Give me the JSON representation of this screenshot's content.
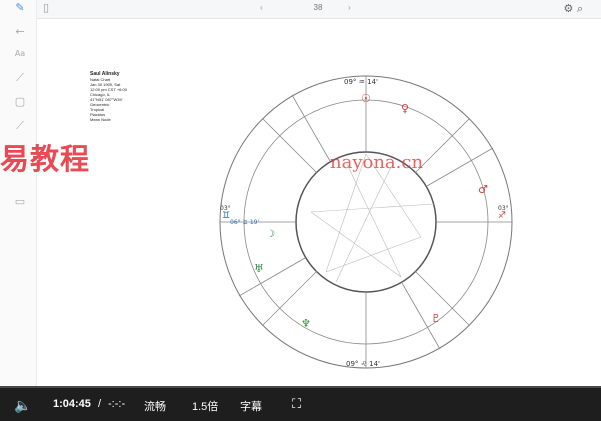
{
  "toolbar": {
    "page_indicator": "38",
    "icons": [
      "pen-icon",
      "sidebar-icon",
      "search-icon",
      "more-icon"
    ]
  },
  "sidebar": {
    "tools": [
      "pen-icon",
      "arrow-icon",
      "text-icon",
      "line-icon",
      "rectangle-icon",
      "highlighter-icon",
      "eraser-icon"
    ]
  },
  "info": {
    "name": "Saul Alinsky",
    "lines": [
      "Natal Chart",
      "Jan 30 1909, Sat",
      "12:00 pm  CST +6:00",
      "Chicago, IL",
      "41°N51' 087°W39'",
      "Geocentric",
      "Tropical",
      "Placidus",
      "Mean Node"
    ]
  },
  "overlay_text": "易教程",
  "watermark": "nayona.cn",
  "chart_labels": {
    "top": "09° ♒ 14'",
    "bottom": "09° ♌ 14'",
    "left_sign": "♊",
    "right_sign": "♐",
    "left_deg": "03°",
    "right_deg": "03°",
    "moon": "06° ♊ 19'"
  },
  "player": {
    "time_current": "1:04:45",
    "separator": "/",
    "time_total": "-:-:-",
    "quality": "流畅",
    "speed": "1.5倍",
    "subtitle": "字幕",
    "progress": 0.0
  }
}
